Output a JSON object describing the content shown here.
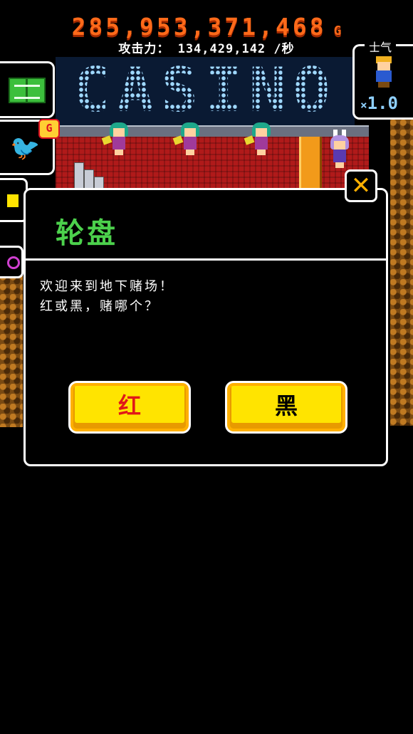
{
  "hud": {
    "gold": "285,953,371,468",
    "gold_unit": "G",
    "attack_label": "攻击力：",
    "attack_value": "134,429,142",
    "attack_unit": "/秒"
  },
  "scene": {
    "sign_text": "CASINO"
  },
  "side": {
    "book_icon": "book-icon",
    "twitter_icon": "twitter-bird-icon",
    "twitter_badge": "G",
    "morale_label": "士气",
    "morale_multiplier_prefix": "×",
    "morale_multiplier": "1.0"
  },
  "dialog": {
    "title": "轮盘",
    "message_line1": "欢迎来到地下赌场！",
    "message_line2": "红或黑，赌哪个？",
    "red_label": "红",
    "black_label": "黑",
    "close_symbol": "✕"
  },
  "colors": {
    "gold": "#ff6a1a",
    "title_green": "#4cd14c",
    "button_yellow": "#ffe400",
    "red_text": "#e01818",
    "close_orange": "#ffb000"
  }
}
